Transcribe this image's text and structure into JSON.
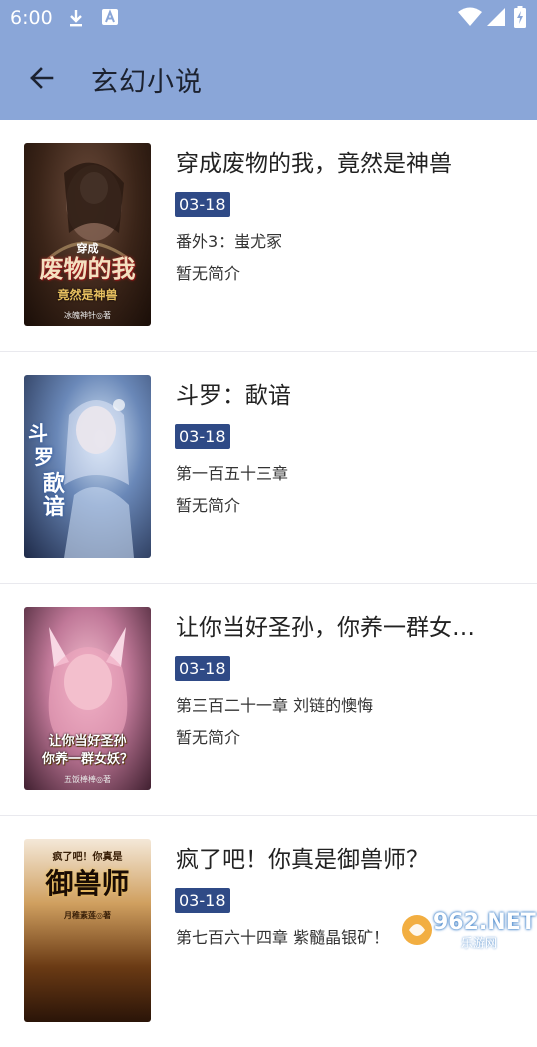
{
  "status_bar": {
    "time": "6:00"
  },
  "app_bar": {
    "title": "玄幻小说"
  },
  "books": [
    {
      "title": "穿成废物的我，竟然是神兽",
      "date": "03-18",
      "chapter": "番外3：蚩尤冢",
      "intro": "暂无简介",
      "cover": {
        "line1": "穿成",
        "line2": "废物的我",
        "line3": "竟然是神兽",
        "author": "冰魄神针◎著",
        "bg": "#3a2418",
        "accent": "#e8c060"
      }
    },
    {
      "title": "斗罗：歃谙",
      "date": "03-18",
      "chapter": "第一百五十三章",
      "intro": "暂无简介",
      "cover": {
        "line1": "斗",
        "line2": "罗",
        "line3": "歃谙",
        "author": "",
        "bg": "#2c3a5a",
        "accent": "#a8d8f0"
      }
    },
    {
      "title": "让你当好圣孙，你养一群女…",
      "date": "03-18",
      "chapter": "第三百二十一章 刘链的懊悔",
      "intro": "暂无简介",
      "cover": {
        "line1": "让你当好圣孙",
        "line2": "你养一群女妖？",
        "line3": "",
        "author": "五饭棒棒◎著",
        "bg": "#b07090",
        "accent": "#f0d050"
      }
    },
    {
      "title": "疯了吧！你真是御兽师？",
      "date": "03-18",
      "chapter": "第七百六十四章 紫髓晶银矿！",
      "intro": "",
      "cover": {
        "line1": "疯了吧！你真是",
        "line2": "御兽师",
        "line3": "",
        "author": "月稚素莲◎著",
        "bg": "#5a3a1a",
        "accent": "#f0c050"
      }
    }
  ],
  "watermark": {
    "text": "962.NET",
    "sub": "乐游网"
  }
}
